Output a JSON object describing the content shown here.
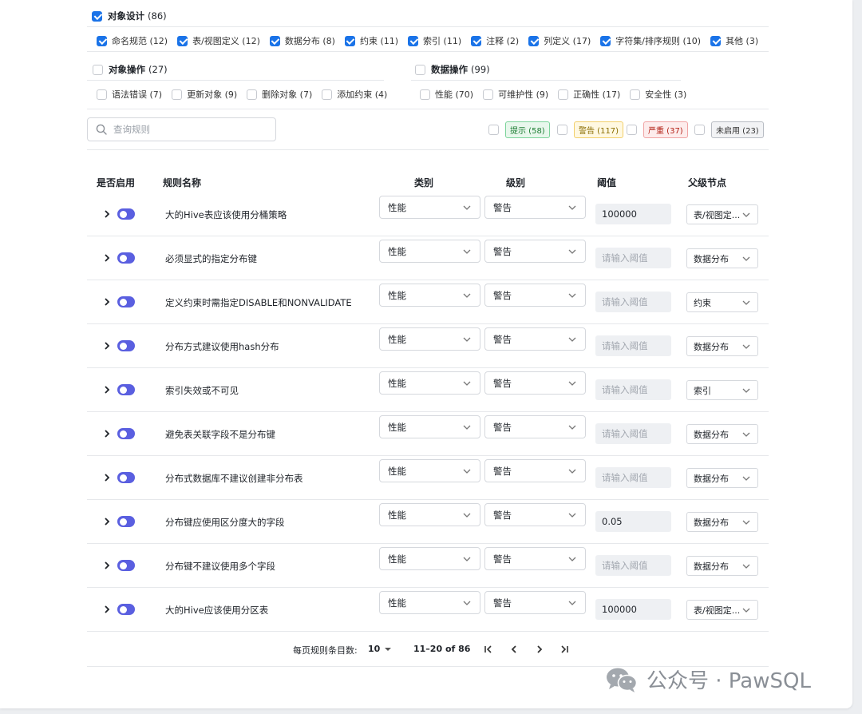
{
  "object_design": {
    "label": "对象设计",
    "count": "(86)",
    "items": [
      {
        "label": "命名规范 (12)"
      },
      {
        "label": "表/视图定义 (12)"
      },
      {
        "label": "数据分布 (8)"
      },
      {
        "label": "约束 (11)"
      },
      {
        "label": "索引 (11)"
      },
      {
        "label": "注释 (2)"
      },
      {
        "label": "列定义 (17)"
      },
      {
        "label": "字符集/排序规则 (10)"
      },
      {
        "label": "其他 (3)"
      }
    ]
  },
  "object_ops": {
    "label": "对象操作",
    "count": "(27)",
    "items": [
      {
        "label": "语法错误 (7)"
      },
      {
        "label": "更新对象 (9)"
      },
      {
        "label": "删除对象 (7)"
      },
      {
        "label": "添加约束 (4)"
      }
    ]
  },
  "data_ops": {
    "label": "数据操作",
    "count": "(99)",
    "items": [
      {
        "label": "性能 (70)"
      },
      {
        "label": "可维护性 (9)"
      },
      {
        "label": "正确性 (17)"
      },
      {
        "label": "安全性 (3)"
      }
    ]
  },
  "search": {
    "placeholder": "查询规则"
  },
  "levels": [
    {
      "label": "提示 (58)",
      "color": "#1e7e34",
      "bg": "#e8f7ec",
      "border": "#7bd39a"
    },
    {
      "label": "警告 (117)",
      "color": "#8a6d00",
      "bg": "#fff8e1",
      "border": "#f2cf6b"
    },
    {
      "label": "严重 (37)",
      "color": "#b42318",
      "bg": "#fdecec",
      "border": "#f0a3a3"
    },
    {
      "label": "未启用 (23)",
      "color": "#333333",
      "bg": "#f2f3f5",
      "border": "#b8bcc3"
    }
  ],
  "table": {
    "headers": {
      "enabled": "是否启用",
      "name": "规则名称",
      "category": "类别",
      "level": "级别",
      "threshold": "阈值",
      "parent": "父级节点"
    },
    "threshold_placeholder": "请输入阈值",
    "rows": [
      {
        "name": "大的Hive表应该使用分桶策略",
        "category": "性能",
        "level": "警告",
        "threshold": "100000",
        "parent": "表/视图定..."
      },
      {
        "name": "必须显式的指定分布键",
        "category": "性能",
        "level": "警告",
        "threshold": "",
        "parent": "数据分布"
      },
      {
        "name": "定义约束时需指定DISABLE和NONVALIDATE",
        "category": "性能",
        "level": "警告",
        "threshold": "",
        "parent": "约束"
      },
      {
        "name": "分布方式建议使用hash分布",
        "category": "性能",
        "level": "警告",
        "threshold": "",
        "parent": "数据分布"
      },
      {
        "name": "索引失效或不可见",
        "category": "性能",
        "level": "警告",
        "threshold": "",
        "parent": "索引"
      },
      {
        "name": "避免表关联字段不是分布键",
        "category": "性能",
        "level": "警告",
        "threshold": "",
        "parent": "数据分布"
      },
      {
        "name": "分布式数据库不建议创建非分布表",
        "category": "性能",
        "level": "警告",
        "threshold": "",
        "parent": "数据分布"
      },
      {
        "name": "分布键应使用区分度大的字段",
        "category": "性能",
        "level": "警告",
        "threshold": "0.05",
        "parent": "数据分布"
      },
      {
        "name": "分布键不建议使用多个字段",
        "category": "性能",
        "level": "警告",
        "threshold": "",
        "parent": "数据分布"
      },
      {
        "name": "大的Hive应该使用分区表",
        "category": "性能",
        "level": "警告",
        "threshold": "100000",
        "parent": "表/视图定..."
      }
    ]
  },
  "pagination": {
    "per_page_label": "每页规则条目数:",
    "per_page_value": "10",
    "range": "11–20 of 86"
  },
  "watermark": {
    "text": "公众号 · PawSQL"
  }
}
